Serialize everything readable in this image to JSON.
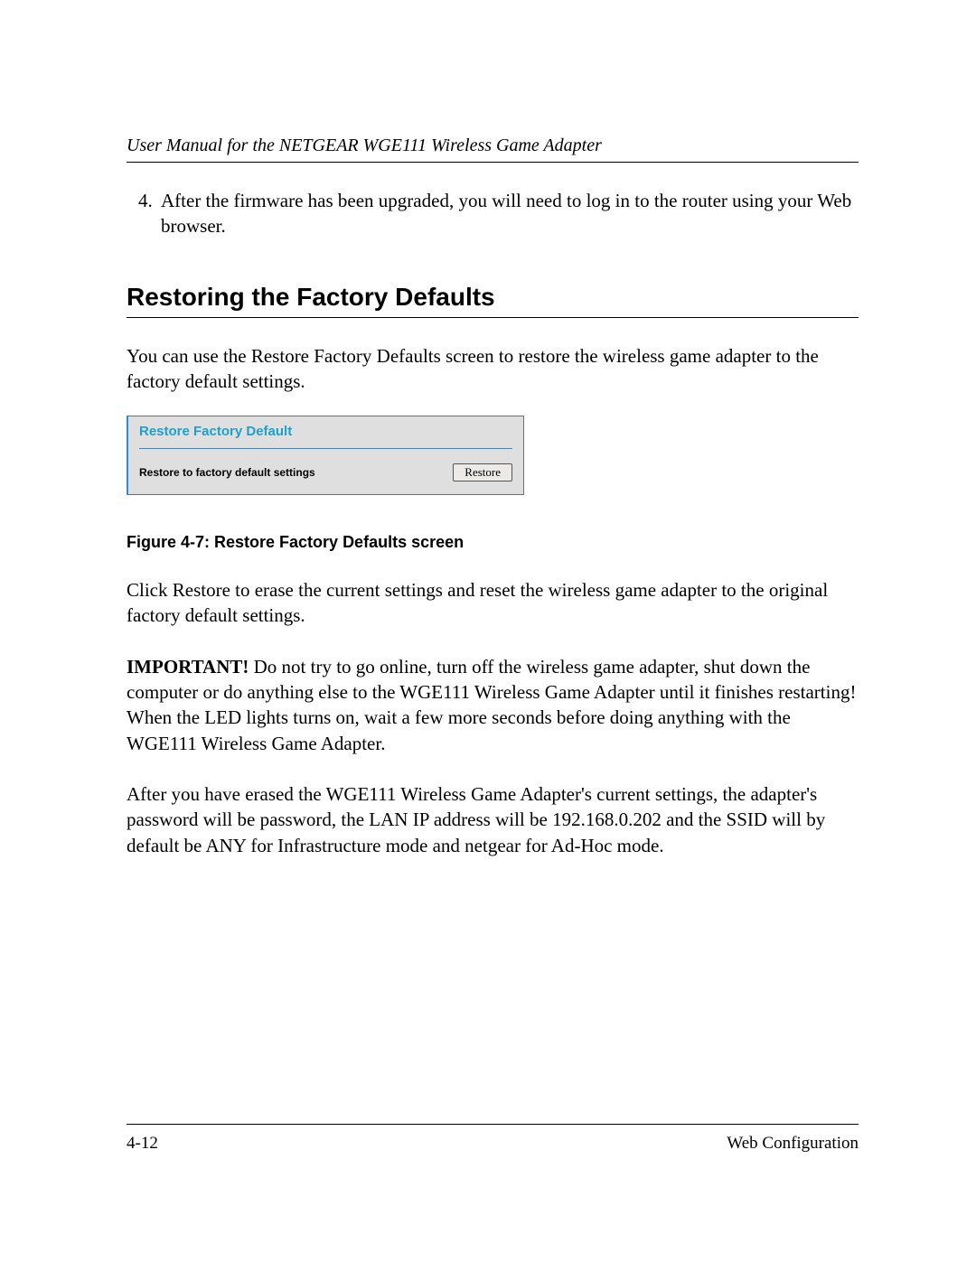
{
  "header": {
    "running_title": "User Manual for the NETGEAR WGE111 Wireless Game Adapter"
  },
  "list": {
    "item4": "After the firmware has been upgraded, you will need to log in to the router using your Web browser."
  },
  "section": {
    "title": "Restoring the Factory Defaults",
    "intro": "You can use the Restore Factory Defaults screen to restore the wireless game adapter to the factory default settings."
  },
  "figure": {
    "panel_title": "Restore Factory Default",
    "panel_label": "Restore to factory default settings",
    "button_label": "Restore",
    "caption": "Figure 4-7:  Restore Factory Defaults screen"
  },
  "para1": "Click Restore to erase the current settings and reset the wireless game adapter to the original factory default settings.",
  "para2": {
    "lead": "IMPORTANT!",
    "rest": " Do not try to go online, turn off the wireless game adapter, shut down the computer or do anything else to the WGE111 Wireless Game Adapter until it finishes restarting! When the LED lights turns on, wait a few more seconds before doing anything with the WGE111 Wireless Game Adapter."
  },
  "para3": "After you have erased the WGE111 Wireless Game Adapter's current settings, the adapter's password will be password, the LAN IP address will be 192.168.0.202 and the SSID will by default be ANY for Infrastructure mode and netgear for Ad-Hoc mode.",
  "footer": {
    "page_number": "4-12",
    "section_name": "Web Configuration"
  }
}
